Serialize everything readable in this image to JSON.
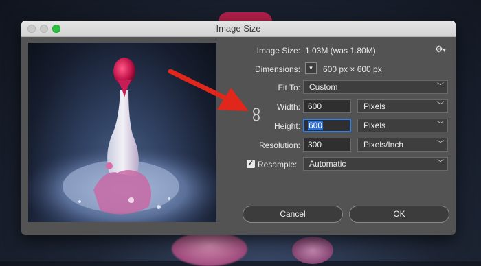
{
  "window": {
    "title": "Image Size"
  },
  "info": {
    "image_size_label": "Image Size:",
    "image_size_value": "1.03M (was 1.80M)",
    "dimensions_label": "Dimensions:",
    "dimensions_value": "600 px  ×  600 px"
  },
  "fit_to": {
    "label": "Fit To:",
    "value": "Custom"
  },
  "width": {
    "label": "Width:",
    "value": "600",
    "unit": "Pixels"
  },
  "height": {
    "label": "Height:",
    "value": "600",
    "unit": "Pixels"
  },
  "resolution": {
    "label": "Resolution:",
    "value": "300",
    "unit": "Pixels/Inch"
  },
  "resample": {
    "label": "Resample:",
    "checked": true,
    "value": "Automatic"
  },
  "buttons": {
    "cancel": "Cancel",
    "ok": "OK"
  },
  "icons": {
    "gear": "gear-icon",
    "link": "chain-link-icon",
    "dropdown": "chevron-down-icon",
    "annotation": "red-arrow-icon"
  },
  "colors": {
    "accent": "#3d7fd6",
    "arrow": "#e1261c",
    "dialog_bg": "#535353"
  }
}
